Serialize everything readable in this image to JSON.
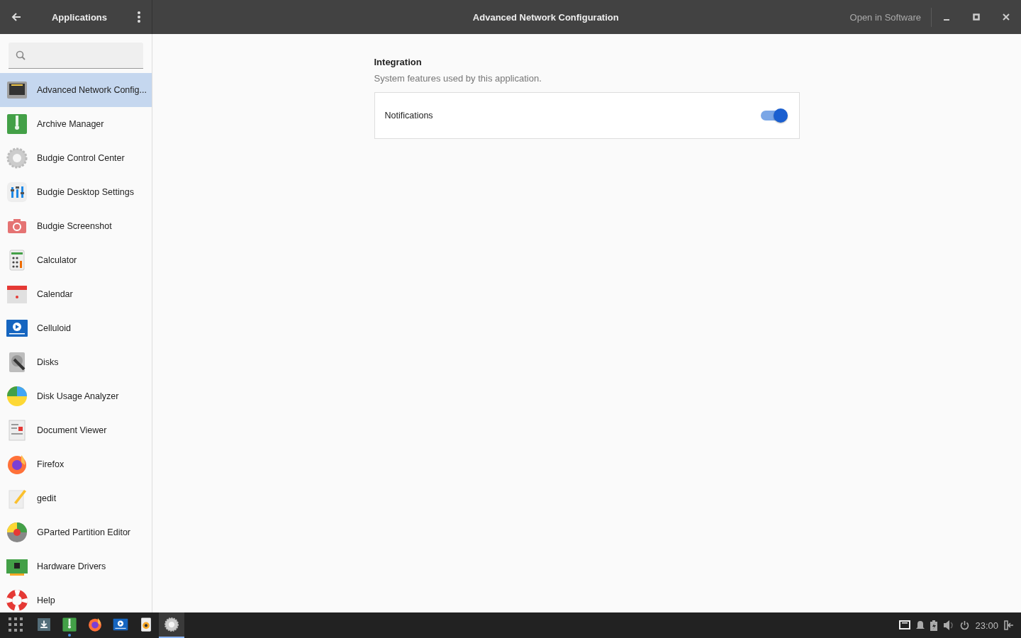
{
  "header": {
    "sidebar_title": "Applications",
    "title": "Advanced Network Configuration",
    "open_button": "Open in Software"
  },
  "apps": [
    {
      "name": "Advanced Network Config...",
      "kind": "network",
      "selected": true
    },
    {
      "name": "Archive Manager",
      "kind": "archive",
      "selected": false
    },
    {
      "name": "Budgie Control Center",
      "kind": "gear",
      "selected": false
    },
    {
      "name": "Budgie Desktop Settings",
      "kind": "sliders",
      "selected": false
    },
    {
      "name": "Budgie Screenshot",
      "kind": "camera",
      "selected": false
    },
    {
      "name": "Calculator",
      "kind": "calculator",
      "selected": false
    },
    {
      "name": "Calendar",
      "kind": "calendar",
      "selected": false
    },
    {
      "name": "Celluloid",
      "kind": "video",
      "selected": false
    },
    {
      "name": "Disks",
      "kind": "disk",
      "selected": false
    },
    {
      "name": "Disk Usage Analyzer",
      "kind": "pie",
      "selected": false
    },
    {
      "name": "Document Viewer",
      "kind": "document",
      "selected": false
    },
    {
      "name": "Firefox",
      "kind": "firefox",
      "selected": false
    },
    {
      "name": "gedit",
      "kind": "editor",
      "selected": false
    },
    {
      "name": "GParted Partition Editor",
      "kind": "partition",
      "selected": false
    },
    {
      "name": "Hardware Drivers",
      "kind": "chip",
      "selected": false
    },
    {
      "name": "Help",
      "kind": "lifebuoy",
      "selected": false
    }
  ],
  "section": {
    "title": "Integration",
    "subtitle": "System features used by this application.",
    "settings": [
      {
        "label": "Notifications",
        "on": true
      }
    ]
  },
  "taskbar": {
    "apps": [
      {
        "kind": "download",
        "selected": false,
        "running": false
      },
      {
        "kind": "archive",
        "selected": false,
        "running": true
      },
      {
        "kind": "firefox",
        "selected": false,
        "running": false
      },
      {
        "kind": "video",
        "selected": false,
        "running": false
      },
      {
        "kind": "speaker",
        "selected": false,
        "running": false
      },
      {
        "kind": "gear",
        "selected": true,
        "running": false
      }
    ],
    "clock": "23:00"
  }
}
